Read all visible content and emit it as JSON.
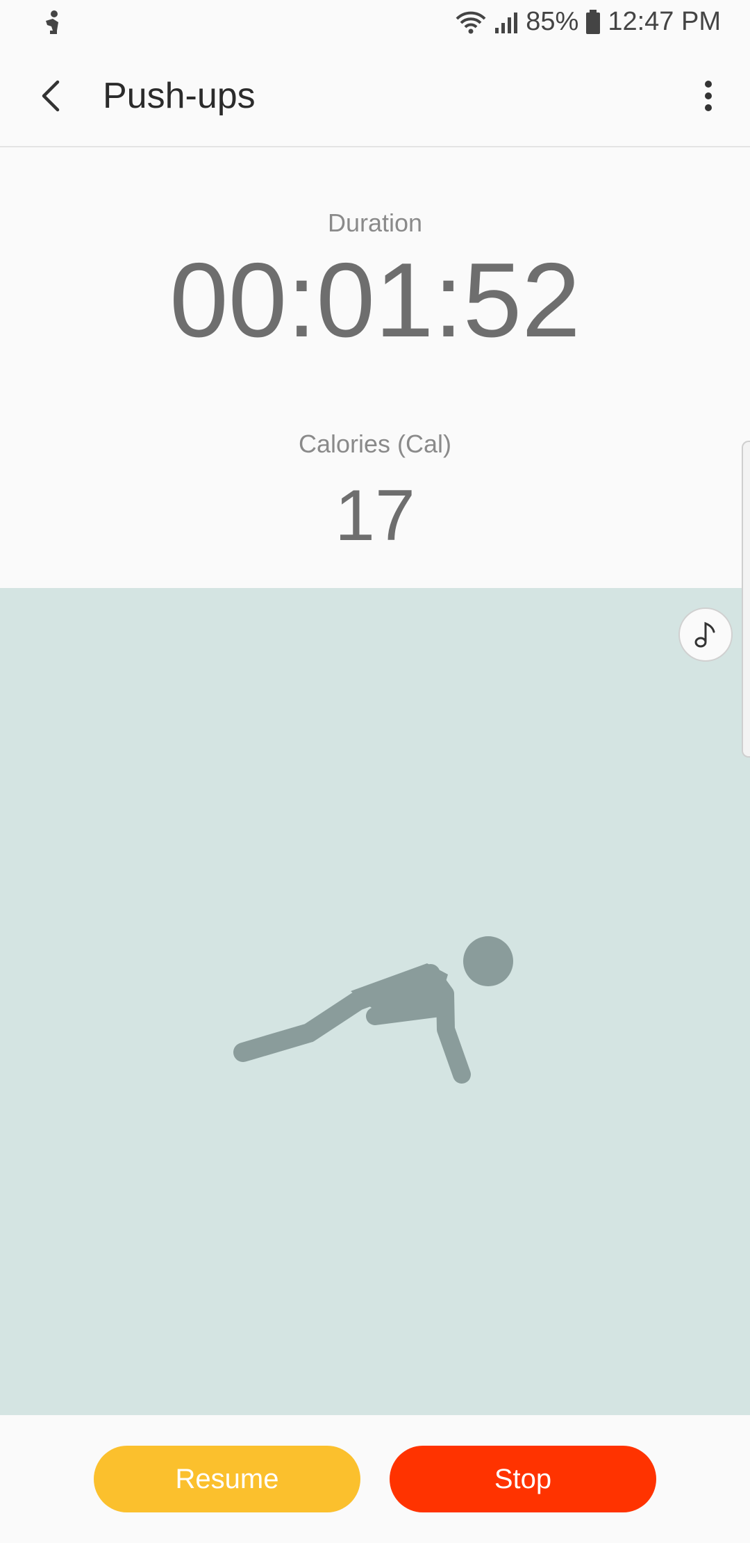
{
  "status_bar": {
    "battery_percent": "85%",
    "time": "12:47 PM",
    "icons": [
      "exercise-notification-icon",
      "wifi-icon",
      "signal-icon",
      "battery-icon"
    ]
  },
  "app_bar": {
    "title": "Push-ups",
    "icons": [
      "back-arrow-icon",
      "more-options-icon"
    ]
  },
  "metrics": {
    "duration_label": "Duration",
    "duration_value": "00:01:52",
    "calories_label": "Calories (Cal)",
    "calories_value": "17"
  },
  "illustration": {
    "icon": "pushup-figure-icon",
    "music_icon": "music-note-icon",
    "background_color": "#d4e4e2",
    "figure_color": "#8a9c9b"
  },
  "actions": {
    "resume_label": "Resume",
    "stop_label": "Stop",
    "resume_color": "#fbc02d",
    "stop_color": "#ff3300"
  }
}
